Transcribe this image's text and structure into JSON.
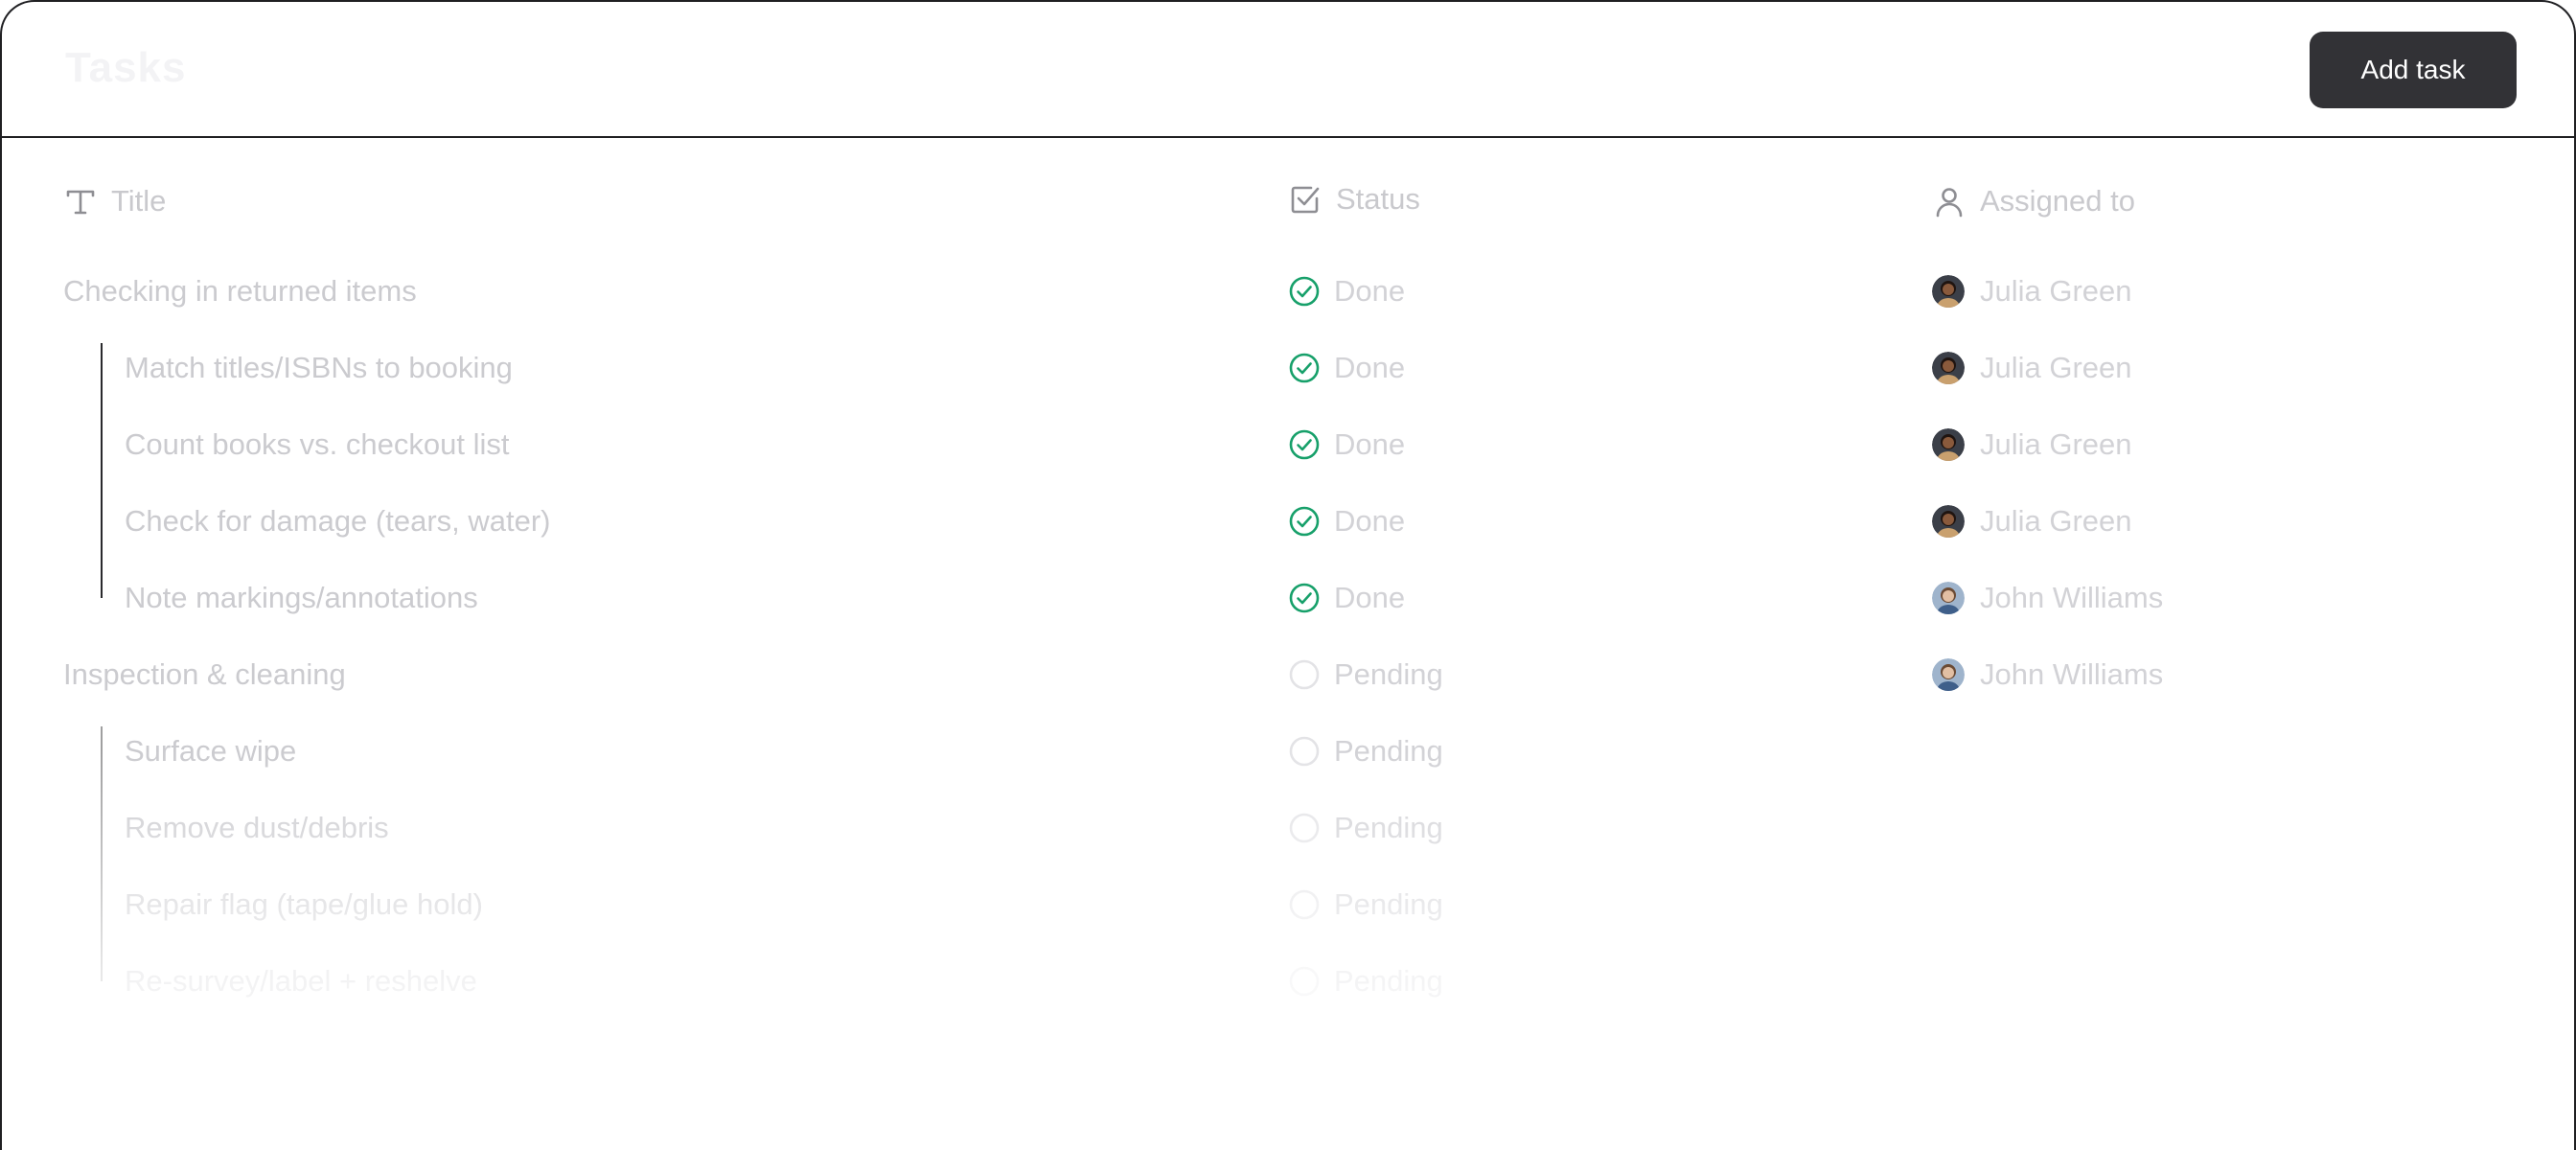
{
  "header": {
    "app_title": "Tasks",
    "add_task_label": "Add task"
  },
  "columns": {
    "title": "Title",
    "status": "Status",
    "assigned": "Assigned to"
  },
  "colors": {
    "done": "#17a06a",
    "pending": "#e3e3e6",
    "button_bg": "#323236",
    "header_text": "#c9c9cd"
  },
  "rows": [
    {
      "title": "Checking in returned items",
      "indent": false,
      "status": "Done",
      "assignee": "Julia Green",
      "avatar": "julia"
    },
    {
      "title": "Match titles/ISBNs to booking",
      "indent": true,
      "status": "Done",
      "assignee": "Julia Green",
      "avatar": "julia"
    },
    {
      "title": "Count books vs. checkout list",
      "indent": true,
      "status": "Done",
      "assignee": "Julia Green",
      "avatar": "julia"
    },
    {
      "title": "Check for damage (tears, water)",
      "indent": true,
      "status": "Done",
      "assignee": "Julia Green",
      "avatar": "julia"
    },
    {
      "title": "Note markings/annotations",
      "indent": true,
      "status": "Done",
      "assignee": "John Williams",
      "avatar": "john"
    },
    {
      "title": "Inspection & cleaning",
      "indent": false,
      "status": "Pending",
      "assignee": "John Williams",
      "avatar": "john"
    },
    {
      "title": "Surface wipe",
      "indent": true,
      "status": "Pending",
      "assignee": "",
      "avatar": ""
    },
    {
      "title": "Remove dust/debris",
      "indent": true,
      "status": "Pending",
      "assignee": "",
      "avatar": ""
    },
    {
      "title": "Repair flag (tape/glue hold)",
      "indent": true,
      "status": "Pending",
      "assignee": "",
      "avatar": ""
    },
    {
      "title": "Re-survey/label + reshelve",
      "indent": true,
      "status": "Pending",
      "assignee": "",
      "avatar": ""
    }
  ]
}
